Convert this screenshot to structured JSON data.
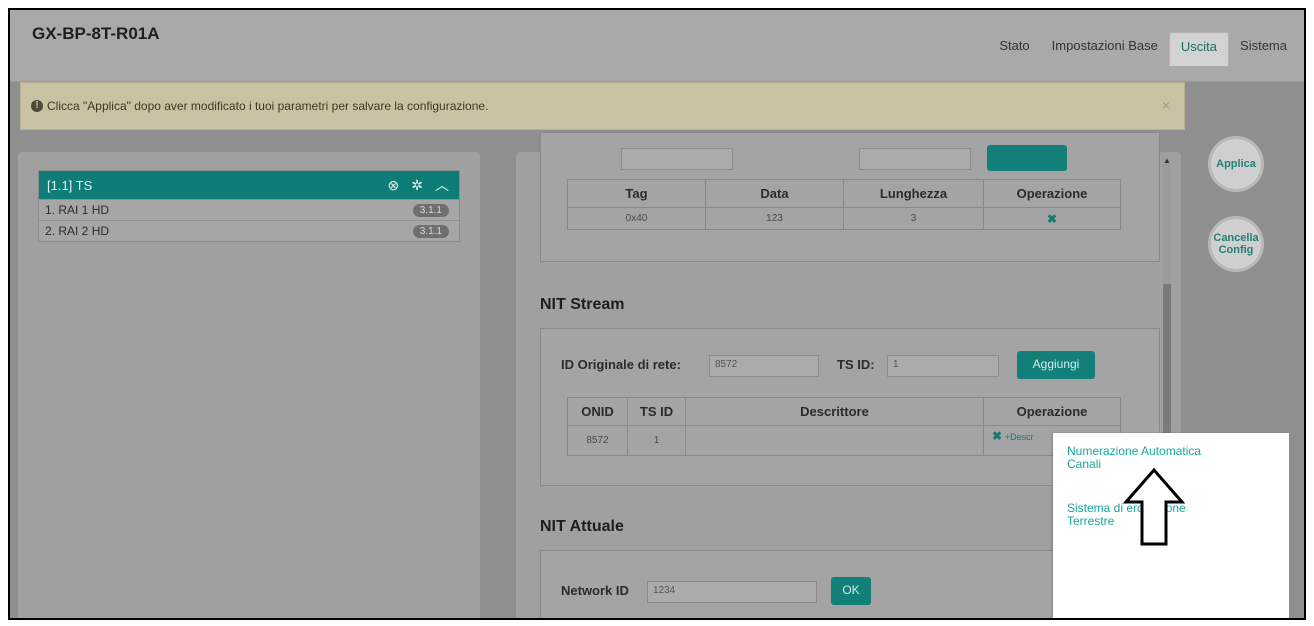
{
  "header": {
    "brand": "GX-BP-8T-R01A",
    "tabs": [
      {
        "label": "Stato"
      },
      {
        "label": "Impostazioni Base"
      },
      {
        "label": "Uscita",
        "active": true
      },
      {
        "label": "Sistema"
      }
    ]
  },
  "alert": {
    "icon": "exclamation-circle-icon",
    "text": "Clicca \"Applica\" dopo aver modificato i tuoi parametri per salvare la configurazione.",
    "close": "×"
  },
  "ts_list": {
    "title": "[1.1] TS",
    "icons": [
      "close-circle-icon",
      "gear-icon",
      "chevron-up-icon"
    ],
    "items": [
      {
        "label": "1. RAI 1 HD",
        "badge": "3.1.1"
      },
      {
        "label": "2. RAI 2 HD",
        "badge": "3.1.1"
      }
    ]
  },
  "descriptor_table": {
    "headers": [
      "Tag",
      "Data",
      "Lunghezza",
      "Operazione"
    ],
    "rows": [
      {
        "tag": "0x40",
        "data": "123",
        "length": "3",
        "operation": "✖"
      }
    ]
  },
  "nit_stream": {
    "title": "NIT Stream",
    "onid_label": "ID Originale di rete:",
    "onid_value": "8572",
    "tsid_label": "TS ID:",
    "tsid_value": "1",
    "add_label": "Aggiungi",
    "table": {
      "headers": [
        "ONID",
        "TS ID",
        "Descrittore",
        "Operazione"
      ],
      "rows": [
        {
          "onid": "8572",
          "tsid": "1",
          "descriptor": "",
          "delete": "✖",
          "add": "+Descr"
        }
      ]
    }
  },
  "nit_attuale": {
    "title": "NIT Attuale",
    "network_label": "Network ID",
    "network_value": "1234",
    "ok_label": "OK"
  },
  "side_buttons": {
    "apply": "Applica",
    "cancel_line1": "Cancella",
    "cancel_line2": "Config"
  },
  "popup": {
    "items": [
      {
        "line1": "Numerazione Automatica",
        "line2": "Canali"
      },
      {
        "line1": "Sistema di erogazione",
        "line2": "Terrestre"
      }
    ]
  },
  "colors": {
    "accent": "#127f79",
    "link": "#1aa69c"
  }
}
